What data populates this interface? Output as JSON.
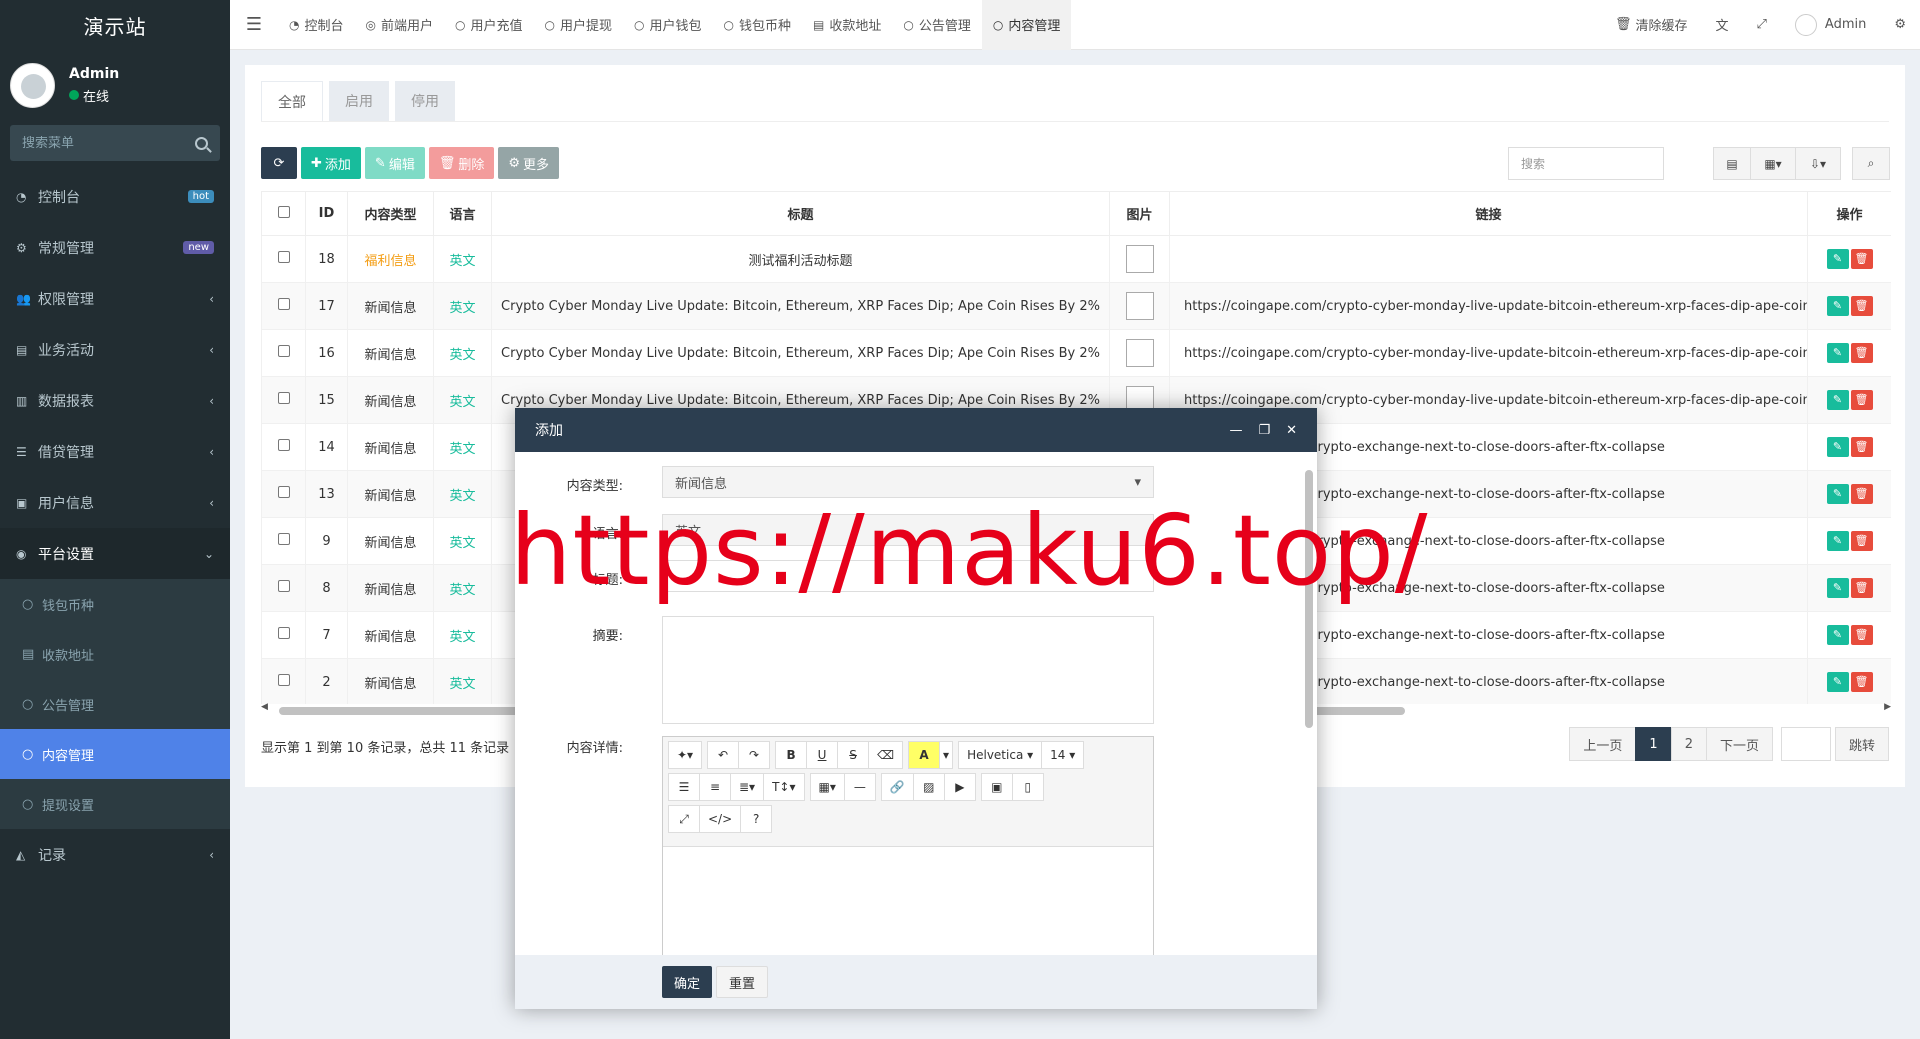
{
  "sidebar": {
    "logo": "演示站",
    "user_name": "Admin",
    "user_status": "在线",
    "search_placeholder": "搜索菜单",
    "items": [
      {
        "label": "控制台",
        "badge": "hot"
      },
      {
        "label": "常规管理",
        "badge": "new"
      },
      {
        "label": "权限管理"
      },
      {
        "label": "业务活动"
      },
      {
        "label": "数据报表"
      },
      {
        "label": "借贷管理"
      },
      {
        "label": "用户信息"
      },
      {
        "label": "平台设置"
      }
    ],
    "sub_items": [
      {
        "label": "钱包币种"
      },
      {
        "label": "收款地址"
      },
      {
        "label": "公告管理"
      },
      {
        "label": "内容管理"
      },
      {
        "label": "提现设置"
      }
    ],
    "last_item": "记录"
  },
  "topbar": {
    "tabs": [
      "控制台",
      "前端用户",
      "用户充值",
      "用户提现",
      "用户钱包",
      "钱包币种",
      "收款地址",
      "公告管理",
      "内容管理"
    ],
    "clear_cache": "清除缓存",
    "admin": "Admin"
  },
  "filter_tabs": [
    "全部",
    "启用",
    "停用"
  ],
  "toolbar": {
    "add": "添加",
    "edit": "编辑",
    "delete": "删除",
    "more": "更多"
  },
  "table_search_placeholder": "搜索",
  "table": {
    "headers": [
      "ID",
      "内容类型",
      "语言",
      "标题",
      "图片",
      "链接",
      "操作"
    ],
    "rows": [
      {
        "id": "18",
        "type": "福利信息",
        "lang": "英文",
        "title": "测试福利活动标题",
        "link": ""
      },
      {
        "id": "17",
        "type": "新闻信息",
        "lang": "英文",
        "title": "Crypto Cyber Monday Live Update: Bitcoin, Ethereum, XRP Faces Dip; Ape Coin Rises By 2%",
        "link": "https://coingape.com/crypto-cyber-monday-live-update-bitcoin-ethereum-xrp-faces-dip-ape-coin-rises"
      },
      {
        "id": "16",
        "type": "新闻信息",
        "lang": "英文",
        "title": "Crypto Cyber Monday Live Update: Bitcoin, Ethereum, XRP Faces Dip; Ape Coin Rises By 2%",
        "link": "https://coingape.com/crypto-cyber-monday-live-update-bitcoin-ethereum-xrp-faces-dip-ape-coin-rises"
      },
      {
        "id": "15",
        "type": "新闻信息",
        "lang": "英文",
        "title": "Crypto Cyber Monday Live Update: Bitcoin, Ethereum, XRP Faces Dip; Ape Coin Rises By 2%",
        "link": "https://coingape.com/crypto-cyber-monday-live-update-bitcoin-ethereum-xrp-faces-dip-ape-coin-rises"
      },
      {
        "id": "14",
        "type": "新闻信息",
        "lang": "英文",
        "title": "",
        "link": "today/singaporean-crypto-exchange-next-to-close-doors-after-ftx-collapse"
      },
      {
        "id": "13",
        "type": "新闻信息",
        "lang": "英文",
        "title": "",
        "link": "today/singaporean-crypto-exchange-next-to-close-doors-after-ftx-collapse"
      },
      {
        "id": "9",
        "type": "新闻信息",
        "lang": "英文",
        "title": "",
        "link": "today/singaporean-crypto-exchange-next-to-close-doors-after-ftx-collapse"
      },
      {
        "id": "8",
        "type": "新闻信息",
        "lang": "英文",
        "title": "",
        "link": "today/singaporean-crypto-exchange-next-to-close-doors-after-ftx-collapse"
      },
      {
        "id": "7",
        "type": "新闻信息",
        "lang": "英文",
        "title": "",
        "link": "today/singaporean-crypto-exchange-next-to-close-doors-after-ftx-collapse"
      },
      {
        "id": "2",
        "type": "新闻信息",
        "lang": "英文",
        "title": "",
        "link": "today/singaporean-crypto-exchange-next-to-close-doors-after-ftx-collapse"
      }
    ]
  },
  "footer_info": "显示第 1 到第 10 条记录，总共 11 条记录",
  "pagination": {
    "prev": "上一页",
    "pages": [
      "1",
      "2"
    ],
    "next": "下一页",
    "jump": "跳转"
  },
  "modal": {
    "title": "添加",
    "label_type": "内容类型:",
    "type_value": "新闻信息",
    "label_lang": "语言:",
    "lang_value": "英文",
    "label_title": "标题:",
    "label_summary": "摘要:",
    "label_detail": "内容详情:",
    "font_name": "Helvetica",
    "font_size": "14",
    "ok": "确定",
    "reset": "重置"
  },
  "watermark": "https://maku6.top/"
}
